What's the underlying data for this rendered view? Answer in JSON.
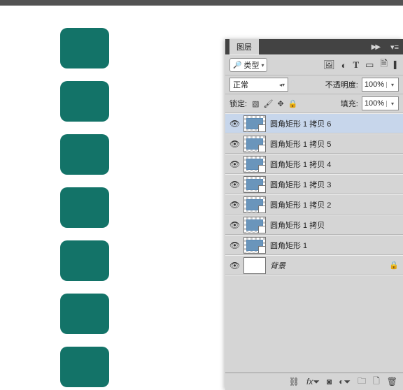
{
  "canvas": {
    "shape_color": "#137368",
    "count": 7
  },
  "panel": {
    "tab_label": "图层",
    "kind_label": "类型",
    "blend_mode": "正常",
    "opacity_label": "不透明度:",
    "opacity_value": "100%",
    "lock_label": "锁定:",
    "fill_label": "填充:",
    "fill_value": "100%"
  },
  "layers": [
    {
      "vis": true,
      "type": "shape",
      "name": "圆角矩形 1 拷贝 6",
      "selected": true
    },
    {
      "vis": true,
      "type": "shape",
      "name": "圆角矩形 1 拷贝 5"
    },
    {
      "vis": true,
      "type": "shape",
      "name": "圆角矩形 1 拷贝 4"
    },
    {
      "vis": true,
      "type": "shape",
      "name": "圆角矩形 1 拷贝 3"
    },
    {
      "vis": true,
      "type": "shape",
      "name": "圆角矩形 1 拷贝 2"
    },
    {
      "vis": true,
      "type": "shape",
      "name": "圆角矩形 1 拷贝"
    },
    {
      "vis": true,
      "type": "shape",
      "name": "圆角矩形 1"
    },
    {
      "vis": true,
      "type": "bg",
      "name": "背景",
      "locked": true
    }
  ]
}
